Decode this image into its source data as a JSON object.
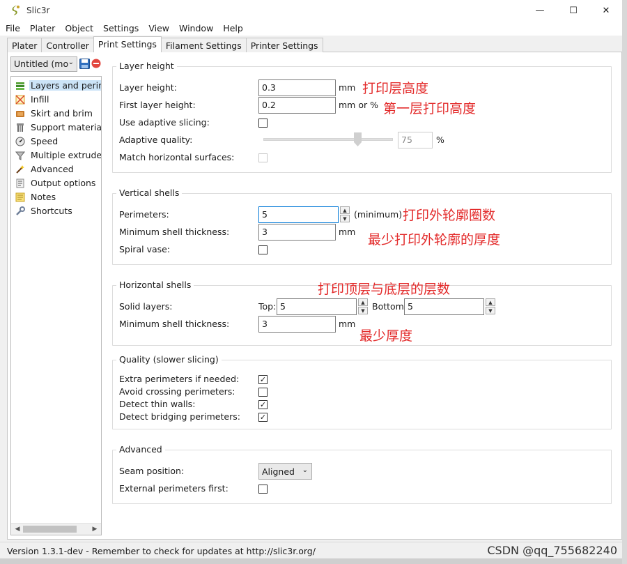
{
  "window": {
    "title": "Slic3r",
    "controls": {
      "minimize": "—",
      "maximize": "☐",
      "close": "✕"
    }
  },
  "menu": [
    "File",
    "Plater",
    "Object",
    "Settings",
    "View",
    "Window",
    "Help"
  ],
  "tabs": [
    "Plater",
    "Controller",
    "Print Settings",
    "Filament Settings",
    "Printer Settings"
  ],
  "active_tab": "Print Settings",
  "preset": {
    "value": "Untitled (mo"
  },
  "categories": [
    {
      "label": "Layers and perimeters",
      "icon": "layers-icon"
    },
    {
      "label": "Infill",
      "icon": "infill-icon"
    },
    {
      "label": "Skirt and brim",
      "icon": "skirt-icon"
    },
    {
      "label": "Support material",
      "icon": "support-icon"
    },
    {
      "label": "Speed",
      "icon": "speed-icon"
    },
    {
      "label": "Multiple extruders",
      "icon": "funnel-icon"
    },
    {
      "label": "Advanced",
      "icon": "wand-icon"
    },
    {
      "label": "Output options",
      "icon": "output-icon"
    },
    {
      "label": "Notes",
      "icon": "note-icon"
    },
    {
      "label": "Shortcuts",
      "icon": "wrench-icon"
    }
  ],
  "layer_height_group": {
    "title": "Layer height",
    "layer_height": {
      "label": "Layer height:",
      "value": "0.3",
      "unit": "mm"
    },
    "first_layer_height": {
      "label": "First layer height:",
      "value": "0.2",
      "unit": "mm or %"
    },
    "adaptive_slicing": {
      "label": "Use adaptive slicing:",
      "checked": false
    },
    "adaptive_quality": {
      "label": "Adaptive quality:",
      "value": "75",
      "unit": "%",
      "slider_fraction": 0.73
    },
    "match_horizontal": {
      "label": "Match horizontal surfaces:",
      "checked": false
    }
  },
  "vertical_shells_group": {
    "title": "Vertical shells",
    "perimeters": {
      "label": "Perimeters:",
      "value": "5",
      "unit": "(minimum)"
    },
    "min_shell_thickness": {
      "label": "Minimum shell thickness:",
      "value": "3",
      "unit": "mm"
    },
    "spiral_vase": {
      "label": "Spiral vase:",
      "checked": false
    }
  },
  "horizontal_shells_group": {
    "title": "Horizontal shells",
    "solid_layers": {
      "label": "Solid layers:",
      "top_label": "Top:",
      "top_value": "5",
      "bottom_label": "Bottom:",
      "bottom_value": "5"
    },
    "min_shell_thickness": {
      "label": "Minimum shell thickness:",
      "value": "3",
      "unit": "mm"
    }
  },
  "quality_group": {
    "title": "Quality (slower slicing)",
    "items": [
      {
        "label": "Extra perimeters if needed:",
        "checked": true
      },
      {
        "label": "Avoid crossing perimeters:",
        "checked": false
      },
      {
        "label": "Detect thin walls:",
        "checked": true
      },
      {
        "label": "Detect bridging perimeters:",
        "checked": true
      }
    ]
  },
  "advanced_group": {
    "title": "Advanced",
    "seam_position": {
      "label": "Seam position:",
      "value": "Aligned"
    },
    "external_perimeters_first": {
      "label": "External perimeters first:",
      "checked": false
    }
  },
  "annotations": {
    "layer_height": "打印层高度",
    "first_layer": "第一层打印高度",
    "perimeters": "打印外轮廓圈数",
    "min_shell": "最少打印外轮廓的厚度",
    "solid_layers": "打印顶层与底层的层数",
    "min_thickness": "最少厚度"
  },
  "status": {
    "text": "Version 1.3.1-dev - Remember to check for updates at http://slic3r.org/"
  },
  "watermark": "CSDN @qq_755682240",
  "colors": {
    "annotation_red": "#e32b2b",
    "selected_bg": "#cce4f7",
    "focus_border": "#0078d7"
  }
}
